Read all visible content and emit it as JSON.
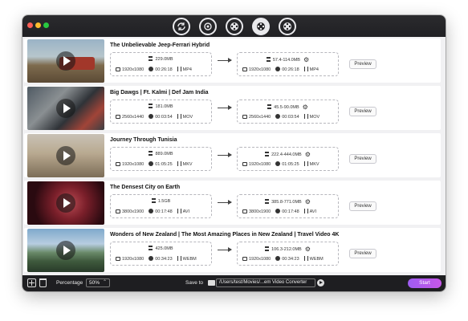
{
  "toolbar": {
    "modes": [
      {
        "icon": "convert-icon",
        "active": false
      },
      {
        "icon": "compress-icon",
        "active": false
      },
      {
        "icon": "film-reel-icon",
        "active": false
      },
      {
        "icon": "film-reel-active-icon",
        "active": true
      },
      {
        "icon": "film-reel-alt-icon",
        "active": false
      }
    ]
  },
  "videos": [
    {
      "title": "The Unbelievable Jeep-Ferrari Hybrid",
      "src": {
        "size": "229.0MB",
        "resolution": "1920x1080",
        "duration": "00:26:18",
        "format": "MP4"
      },
      "dst": {
        "size": "57.4-114.0MB",
        "resolution": "1920x1080",
        "duration": "00:26:18",
        "format": "MP4"
      },
      "preview_label": "Preview"
    },
    {
      "title": "Big Dawgs | Ft. Kalmi | Def Jam India",
      "src": {
        "size": "181.0MB",
        "resolution": "2560x1440",
        "duration": "00:03:54",
        "format": "MOV"
      },
      "dst": {
        "size": "45.5-90.0MB",
        "resolution": "2560x1440",
        "duration": "00:03:54",
        "format": "MOV"
      },
      "preview_label": "Preview"
    },
    {
      "title": "Journey Through Tunisia",
      "src": {
        "size": "889.0MB",
        "resolution": "1920x1080",
        "duration": "01:05:25",
        "format": "MKV"
      },
      "dst": {
        "size": "222.4-444.0MB",
        "resolution": "1920x1080",
        "duration": "01:05:25",
        "format": "MKV"
      },
      "preview_label": "Preview"
    },
    {
      "title": "The Densest City on Earth",
      "src": {
        "size": "1.5GB",
        "resolution": "3800x1900",
        "duration": "00:17:48",
        "format": "AVI"
      },
      "dst": {
        "size": "385.8-771.0MB",
        "resolution": "3800x1900",
        "duration": "00:17:48",
        "format": "AVI"
      },
      "preview_label": "Preview"
    },
    {
      "title": "Wonders of New Zealand  | The Most Amazing Places in New Zealand | Travel Video 4K",
      "src": {
        "size": "425.0MB",
        "resolution": "1920x1080",
        "duration": "00:34:23",
        "format": "WEBM"
      },
      "dst": {
        "size": "106.3-212.0MB",
        "resolution": "1920x1080",
        "duration": "00:34:23",
        "format": "WEBM"
      },
      "preview_label": "Preview"
    }
  ],
  "bottom": {
    "percentage_label": "Percentage",
    "percentage_value": "50%",
    "save_to_label": "Save to",
    "save_path": "/Users/test/Movies/...em Video Converter",
    "start_label": "Start"
  }
}
